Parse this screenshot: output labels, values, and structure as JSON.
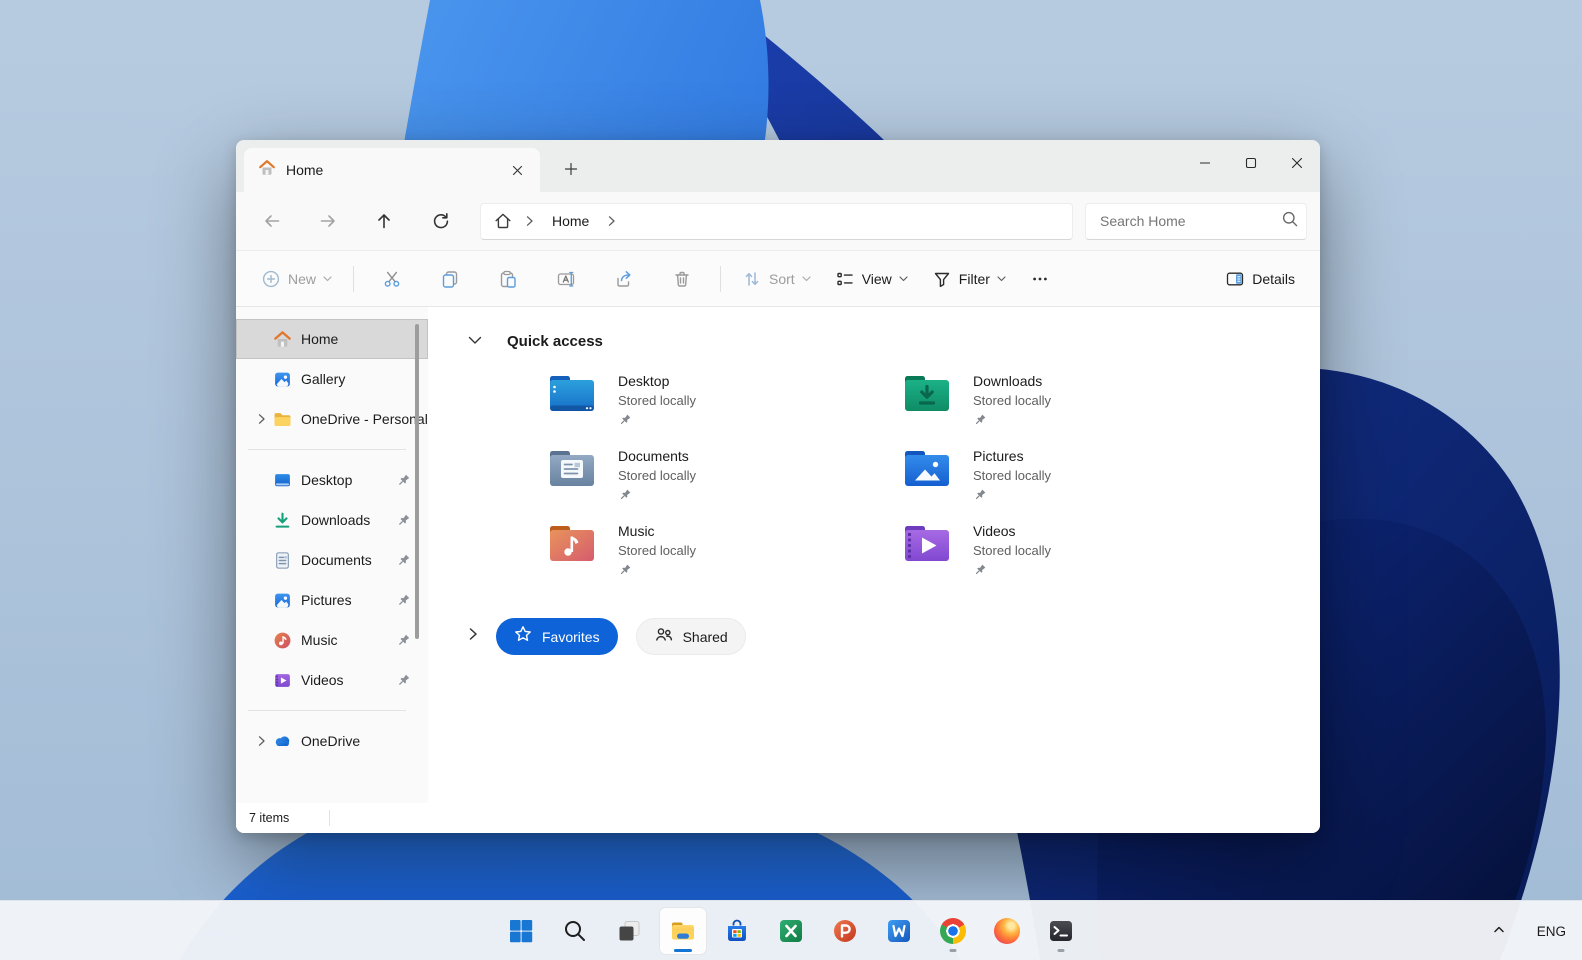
{
  "window": {
    "tab_title": "Home"
  },
  "navigation": {
    "breadcrumb_root": "Home",
    "search_placeholder": "Search Home"
  },
  "toolbar": {
    "new_label": "New",
    "sort_label": "Sort",
    "view_label": "View",
    "filter_label": "Filter",
    "details_label": "Details"
  },
  "sidebar": {
    "items_top": [
      {
        "label": "Home",
        "icon": "home-icon",
        "selected": true
      },
      {
        "label": "Gallery",
        "icon": "gallery-icon",
        "selected": false
      },
      {
        "label": "OneDrive - Personal",
        "icon": "folder-yellow-icon",
        "expandable": true
      }
    ],
    "items_pinned": [
      {
        "label": "Desktop",
        "icon": "desktop-icon",
        "pinned": true
      },
      {
        "label": "Downloads",
        "icon": "downloads-icon",
        "pinned": true
      },
      {
        "label": "Documents",
        "icon": "documents-icon",
        "pinned": true
      },
      {
        "label": "Pictures",
        "icon": "pictures-icon",
        "pinned": true
      },
      {
        "label": "Music",
        "icon": "music-icon",
        "pinned": true
      },
      {
        "label": "Videos",
        "icon": "videos-icon",
        "pinned": true
      }
    ],
    "items_bottom": [
      {
        "label": "OneDrive",
        "icon": "onedrive-cloud-icon",
        "expandable": true
      }
    ]
  },
  "content": {
    "section_title": "Quick access",
    "tiles": [
      {
        "name": "Desktop",
        "subtitle": "Stored locally",
        "icon": "desktop-folder-icon",
        "pinned": true
      },
      {
        "name": "Downloads",
        "subtitle": "Stored locally",
        "icon": "downloads-folder-icon",
        "pinned": true
      },
      {
        "name": "Documents",
        "subtitle": "Stored locally",
        "icon": "documents-folder-icon",
        "pinned": true
      },
      {
        "name": "Pictures",
        "subtitle": "Stored locally",
        "icon": "pictures-folder-icon",
        "pinned": true
      },
      {
        "name": "Music",
        "subtitle": "Stored locally",
        "icon": "music-folder-icon",
        "pinned": true
      },
      {
        "name": "Videos",
        "subtitle": "Stored locally",
        "icon": "videos-folder-icon",
        "pinned": true
      }
    ],
    "pivots": [
      {
        "label": "Favorites",
        "icon": "star-icon",
        "active": true
      },
      {
        "label": "Shared",
        "icon": "people-icon",
        "active": false
      }
    ]
  },
  "status_bar": {
    "items_count": "7 items"
  },
  "taskbar": {
    "icons": [
      "start",
      "search",
      "task-view",
      "file-explorer",
      "microsoft-store",
      "excel",
      "powerpoint",
      "word",
      "chrome",
      "firefox",
      "terminal"
    ],
    "active_app": "file-explorer",
    "running_apps": [
      "chrome",
      "terminal"
    ],
    "tray": {
      "language": "ENG",
      "chevron": "hidden-icons-chevron"
    }
  },
  "colors": {
    "accent_blue": "#0E63D8",
    "selection_gray": "#D9D9D9",
    "taskbar_bg": "#F2F4F7",
    "window_chrome": "#ECEEEE",
    "subtitle_text": "#5F5F5F"
  }
}
